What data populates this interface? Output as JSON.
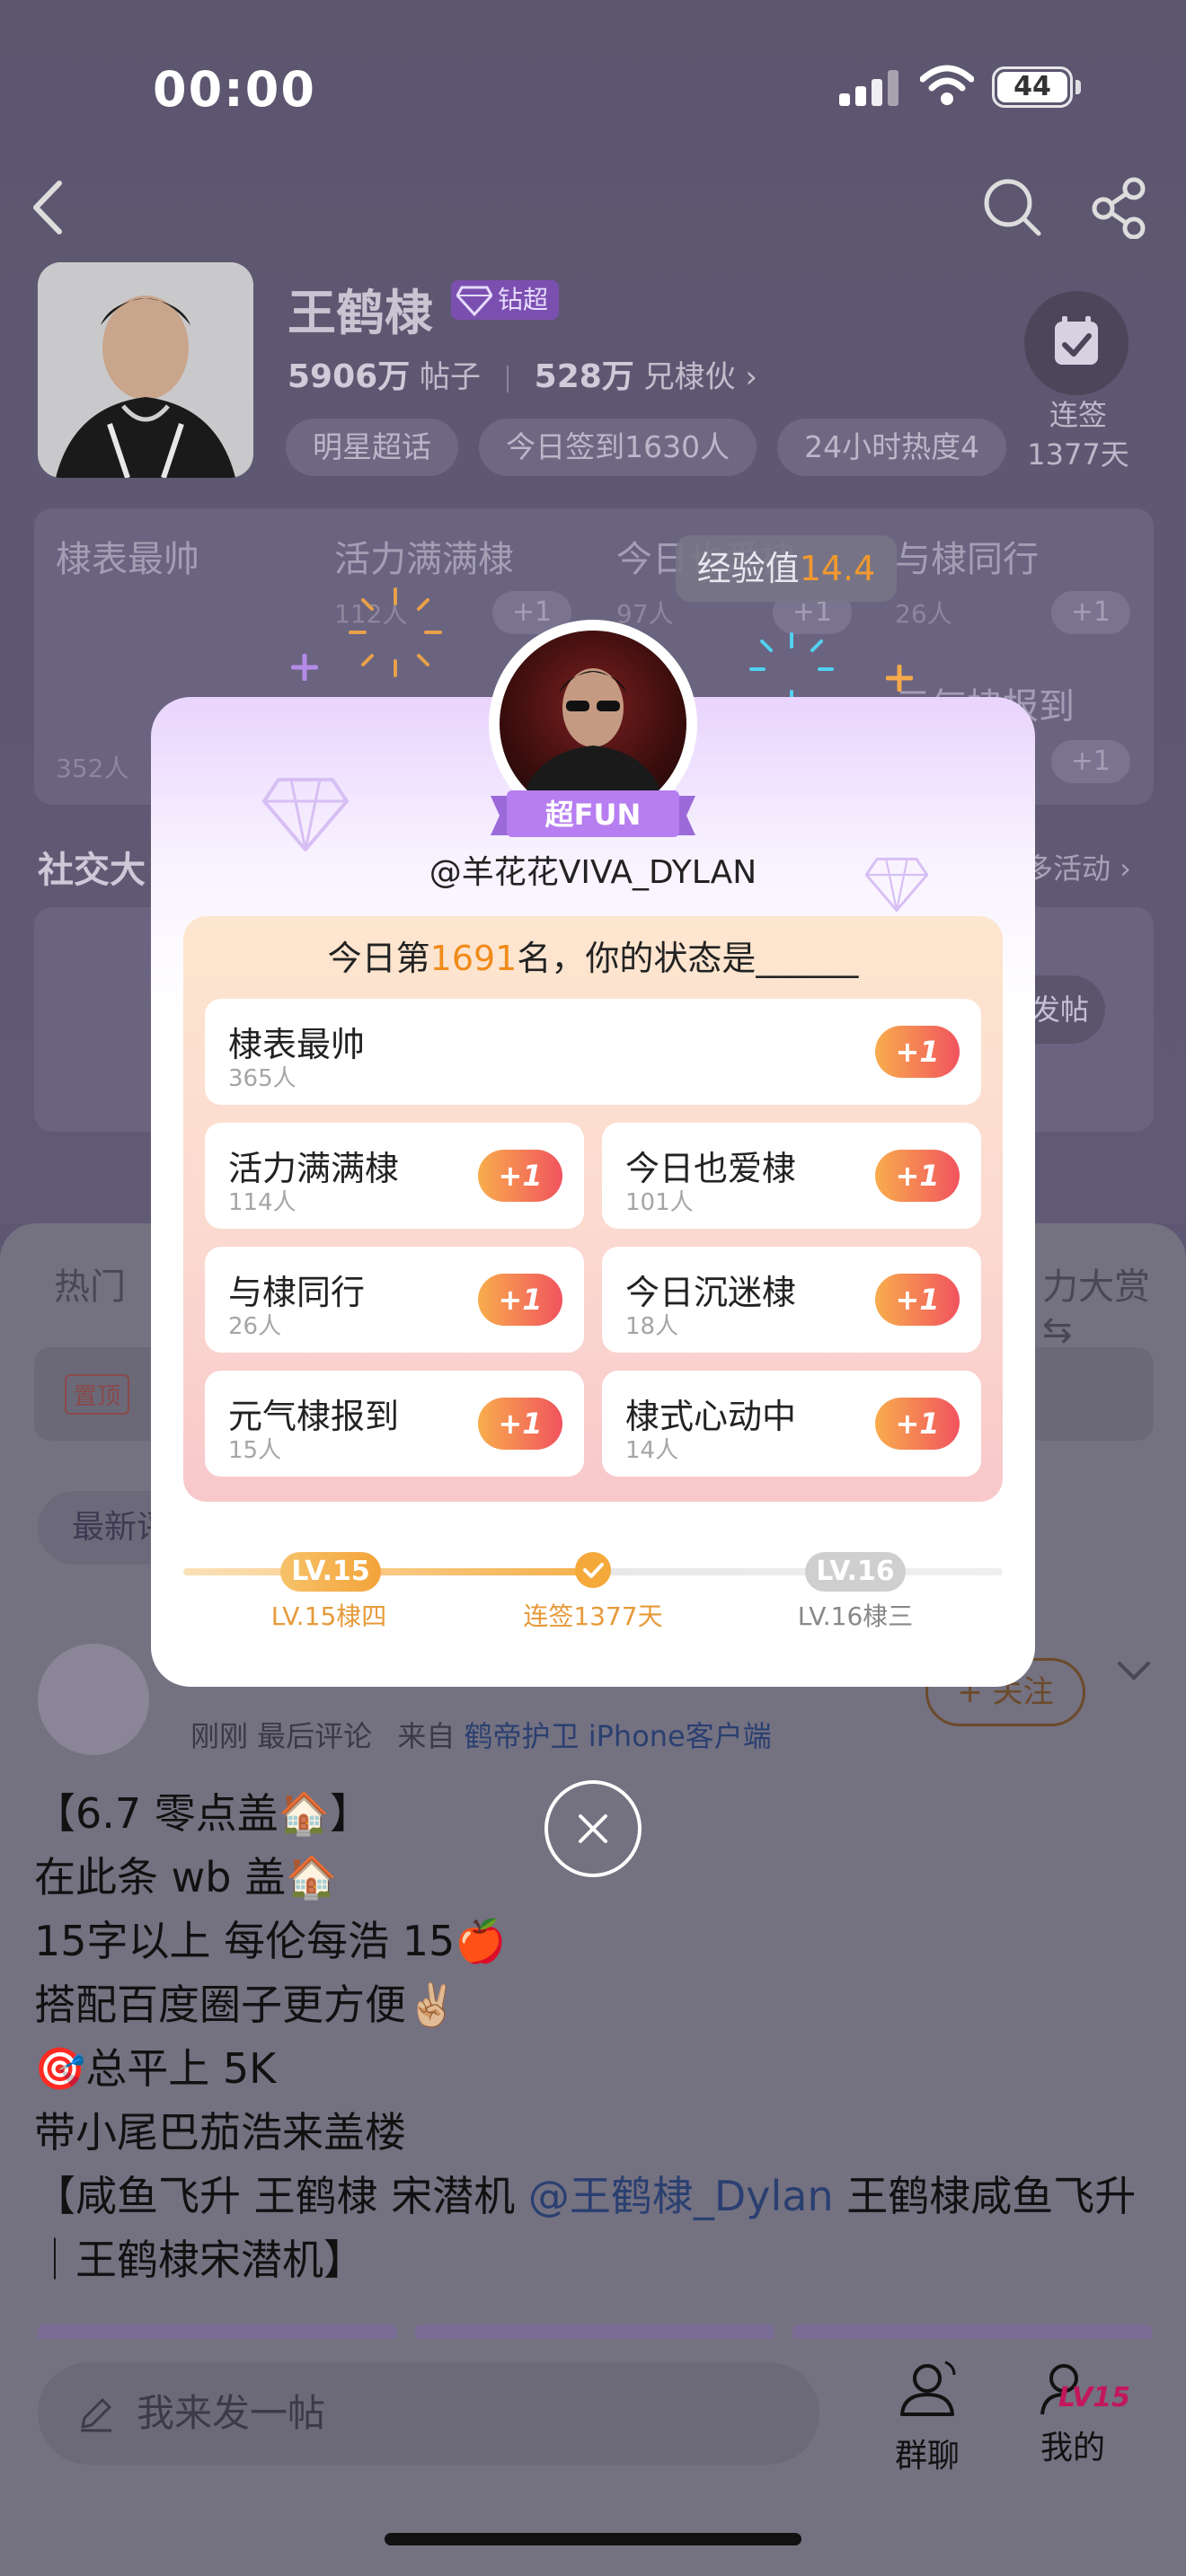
{
  "status_bar": {
    "time": "00:00",
    "battery": "44"
  },
  "profile": {
    "name": "王鹤棣",
    "badge": "钻超",
    "posts_count": "5906万",
    "posts_label": "帖子",
    "fans_count": "528万",
    "fans_label": "兄棣伙",
    "chips": [
      "明星超话",
      "今日签到1630人",
      "24小时热度4"
    ],
    "checkin_label": "连签",
    "checkin_days": "1377天"
  },
  "bg_grid": {
    "items": [
      {
        "title": "棣表最帅",
        "sub": "352人"
      },
      {
        "title": "活力满满棣",
        "sub": "112人"
      },
      {
        "title": "今日也爱棣",
        "sub": "97人"
      },
      {
        "title": "与棣同行",
        "sub": "26人"
      },
      {
        "title": "元气棣报到",
        "sub": ""
      }
    ],
    "plus_label": "+1"
  },
  "social": {
    "title": "社交大",
    "more": "多活动 ›",
    "post_label": "发帖"
  },
  "feed": {
    "tab_hot": "热门",
    "tab_right": "力大赏",
    "pinned_tag": "置顶",
    "latest_label": "最新评",
    "follow_label": "+ 关注",
    "post_meta_time": "刚刚 最后评论",
    "post_meta_from": "来自",
    "post_meta_source": "鹤帝护卫 iPhone客户端",
    "post_lines": [
      "【6.7 零点盖🏠】",
      "在此条 wb 盖🏠",
      "15字以上 每伦每浩 15🍎",
      "搭配百度圈子更方便✌🏼",
      "🎯总平上 5K",
      "带小尾巴茄浩来盖楼"
    ],
    "post_tail_1": "【咸鱼飞升 王鹤棣 宋潜机 ",
    "post_mention": "@王鹤棣_Dylan",
    "post_tail_2": " 王鹤棣咸鱼飞升｜王鹤棣宋潜机】",
    "composer_placeholder": "我来发一帖",
    "group_chat_label": "群聊",
    "mine_label": "我的",
    "mine_level": "LV15"
  },
  "popup": {
    "exp_label": "经验值",
    "exp_value": "14.4",
    "ribbon_label": "超FUN",
    "handle": "@羊花花VIVA_DYLAN",
    "title_prefix": "今日第",
    "rank": "1691",
    "title_suffix": "名，你的状态是______",
    "options": [
      {
        "title": "棣表最帅",
        "count": "365人"
      },
      {
        "title": "活力满满棣",
        "count": "114人"
      },
      {
        "title": "今日也爱棣",
        "count": "101人"
      },
      {
        "title": "与棣同行",
        "count": "26人"
      },
      {
        "title": "今日沉迷棣",
        "count": "18人"
      },
      {
        "title": "元气棣报到",
        "count": "15人"
      },
      {
        "title": "棣式心动中",
        "count": "14人"
      }
    ],
    "plus_label": "+1",
    "level_current": "LV.15",
    "level_current_caption": "LV.15棣四",
    "streak_caption": "连签1377天",
    "level_next": "LV.16",
    "level_next_caption": "LV.16棣三"
  },
  "colors": {
    "accent_orange": "#f08b1a",
    "plus_gradient_start": "#f8ad4d",
    "plus_gradient_end": "#f1535e",
    "ribbon_purple": "#b67ef0"
  }
}
